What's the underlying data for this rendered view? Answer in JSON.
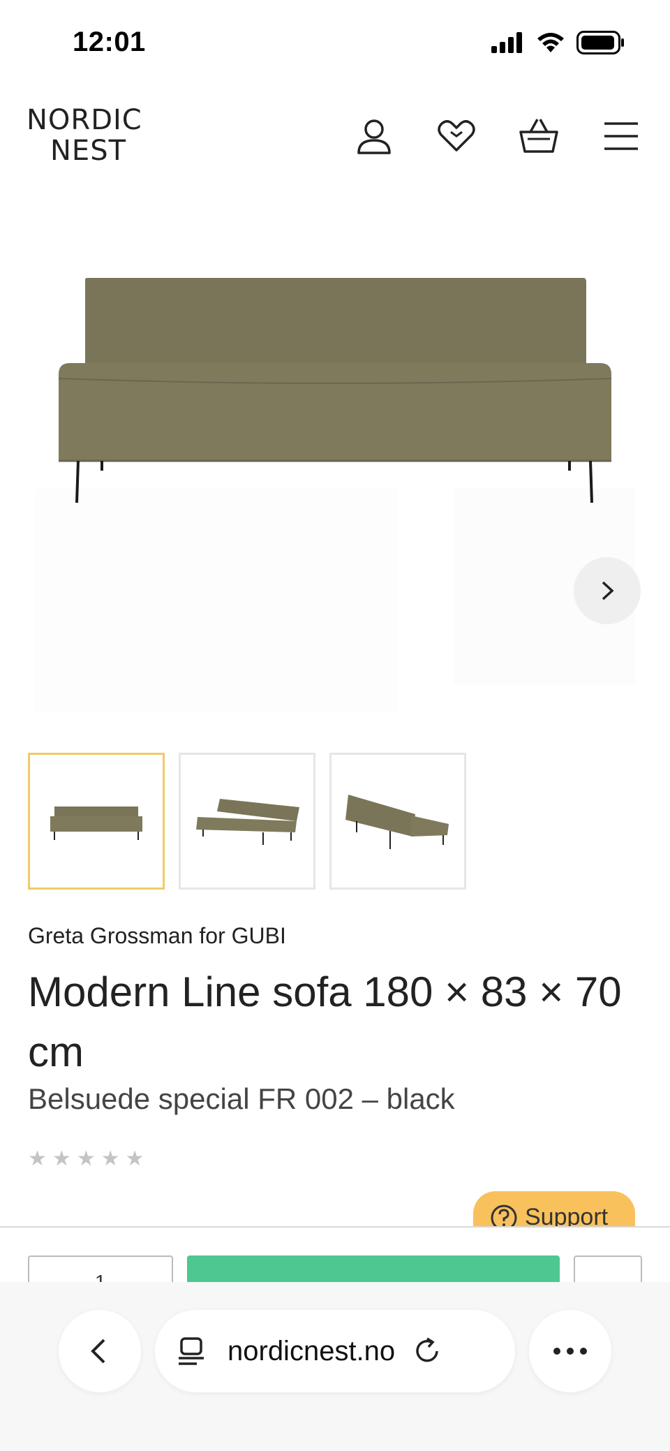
{
  "status_bar": {
    "time": "12:01"
  },
  "header": {
    "logo_line1": "NORDIC",
    "logo_line2": "NEST"
  },
  "product": {
    "designer": "Greta Grossman",
    "connector": "for",
    "brand": "GUBI",
    "title": "Modern Line sofa 180 × 83 × 70 cm",
    "variant": "Belsuede special FR 002 – black",
    "rating_stars": 5,
    "rating_value": 0,
    "image_count": 3,
    "active_image": 1
  },
  "support": {
    "label": "Support"
  },
  "buy": {
    "quantity": "1"
  },
  "browser": {
    "url": "nordicnest.no"
  },
  "colors": {
    "sofa": "#7a7558",
    "accent_yellow": "#f8c15c",
    "thumb_active": "#f2c96a",
    "add_to_cart_green": "#4fc791"
  },
  "icons": [
    "account-icon",
    "wishlist-heart-icon",
    "basket-icon",
    "menu-icon",
    "chevron-right-icon",
    "question-icon",
    "back-icon",
    "reader-icon",
    "reload-icon",
    "more-icon"
  ]
}
